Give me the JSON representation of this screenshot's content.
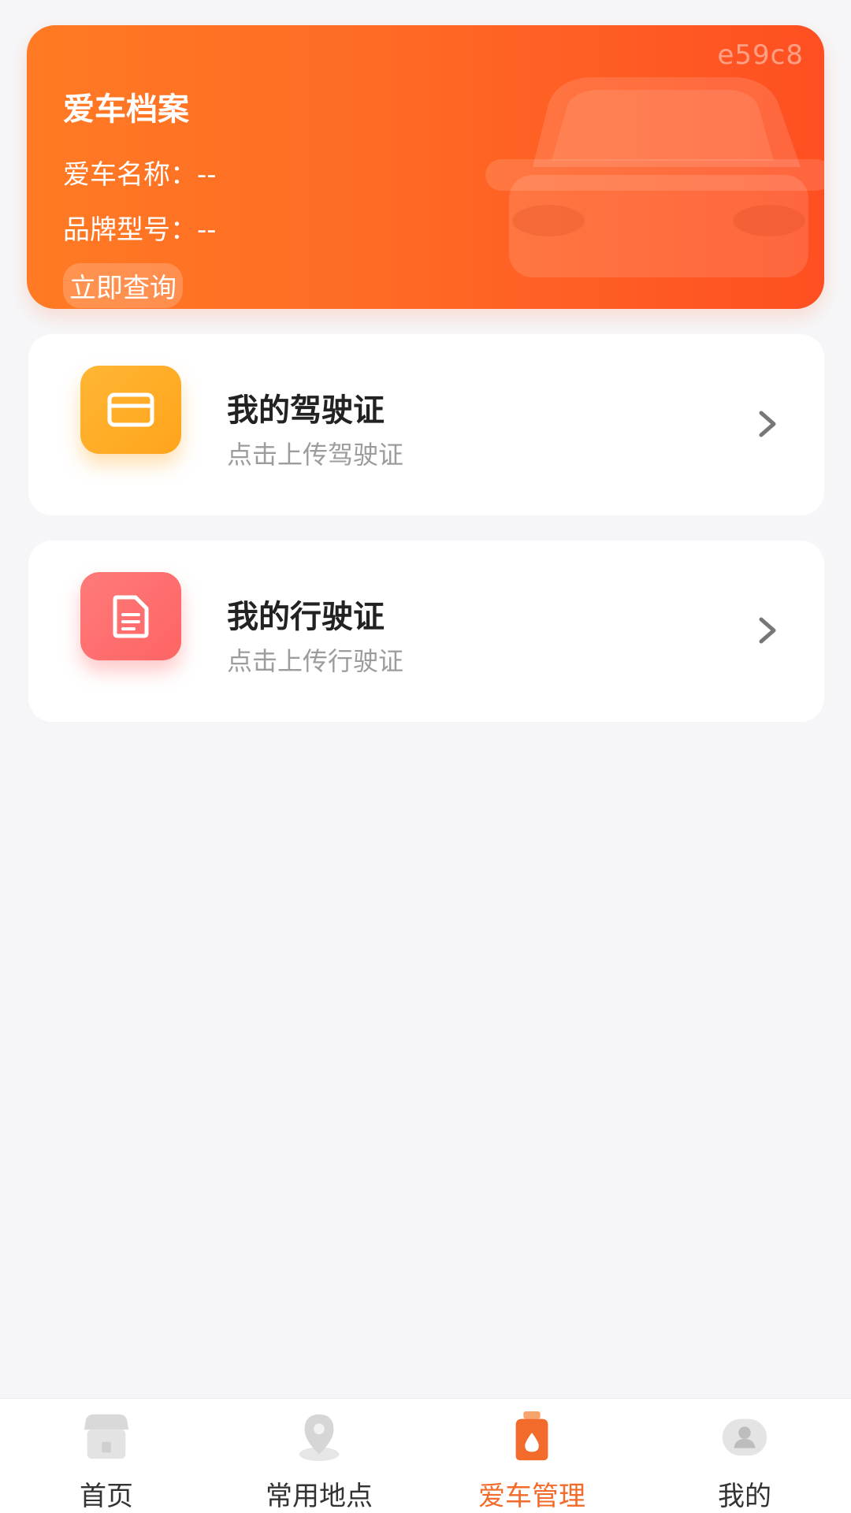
{
  "hero": {
    "watermark": "e59c8",
    "title": "爱车档案",
    "name_label": "爱车名称：",
    "name_value": "--",
    "brand_label": "品牌型号：",
    "brand_value": "--",
    "query_button": "立即查询"
  },
  "cards": [
    {
      "title": "我的驾驶证",
      "subtitle": "点击上传驾驶证",
      "icon": "card-icon"
    },
    {
      "title": "我的行驶证",
      "subtitle": "点击上传行驶证",
      "icon": "document-icon"
    }
  ],
  "tabbar": {
    "items": [
      {
        "label": "首页",
        "icon": "home-icon",
        "active": false
      },
      {
        "label": "常用地点",
        "icon": "location-pin-icon",
        "active": false
      },
      {
        "label": "爱车管理",
        "icon": "car-oil-icon",
        "active": true
      },
      {
        "label": "我的",
        "icon": "user-icon",
        "active": false
      }
    ]
  },
  "colors": {
    "accent": "#f26b2a",
    "hero_start": "#ff7a23",
    "hero_end": "#ff4f22",
    "license_icon": "#ffa41b",
    "registration_icon": "#ff6464"
  }
}
